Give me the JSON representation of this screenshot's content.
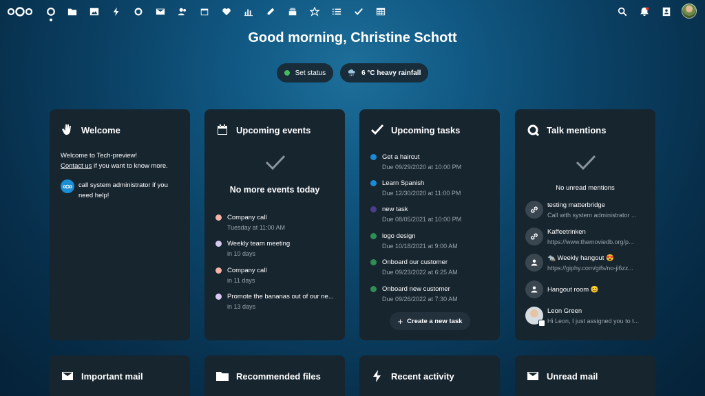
{
  "header": {
    "apps": [
      "Dashboard",
      "Files",
      "Photos",
      "Activity",
      "Talk",
      "Mail",
      "Contacts",
      "Calendar",
      "Favorites",
      "Analytics",
      "Notes",
      "Deck",
      "Bookmarks",
      "Tasks",
      "Checks",
      "Tables"
    ],
    "right": [
      "search-icon",
      "notifications-icon",
      "contacts-menu-icon"
    ]
  },
  "greeting": "Good morning, Christine Schott",
  "status": {
    "set_status": "Set status",
    "weather": "6 °C heavy rainfall"
  },
  "welcome": {
    "title": "Welcome",
    "line1": "Welcome to Tech-preview!",
    "contact_link": "Contact us",
    "line2": " if you want to know more.",
    "admin_line1": "call system administrator if you",
    "admin_line2": "need help!"
  },
  "events": {
    "title": "Upcoming events",
    "empty": "No more events today",
    "items": [
      {
        "title": "Company call",
        "time": "Tuesday at 11:00 AM",
        "color": "#f3b3a8"
      },
      {
        "title": "Weekly team meeting",
        "time": "in 10 days",
        "color": "#d8c9f2"
      },
      {
        "title": "Company call",
        "time": "in 11 days",
        "color": "#f3b3a8"
      },
      {
        "title": "Promote the bananas out of our ne...",
        "time": "in 13 days",
        "color": "#d8c9f2"
      }
    ]
  },
  "tasks": {
    "title": "Upcoming tasks",
    "create": "Create a new task",
    "items": [
      {
        "title": "Get a haircut",
        "due": "Due 09/29/2020 at 10:00 PM",
        "color": "#1a8ad6"
      },
      {
        "title": "Learn Spanish",
        "due": "Due 12/30/2020 at 11:00 PM",
        "color": "#1a8ad6"
      },
      {
        "title": "new task",
        "due": "Due 08/05/2021 at 10:00 PM",
        "color": "#4a3d8f"
      },
      {
        "title": "logo design",
        "due": "Due 10/18/2021 at 9:00 AM",
        "color": "#2e8f54"
      },
      {
        "title": "Onboard our customer",
        "due": "Due 09/23/2022 at 6:25 AM",
        "color": "#2e8f54"
      },
      {
        "title": "Onboard new customer",
        "due": "Due 09/26/2022 at 7:30 AM",
        "color": "#2e8f54"
      }
    ]
  },
  "talk": {
    "title": "Talk mentions",
    "empty": "No unread mentions",
    "items": [
      {
        "title": "testing matterbridge",
        "sub": "Call with system administrator ...",
        "icon": "link-icon"
      },
      {
        "title": "Kaffeetrinken",
        "sub": "https://www.themoviedb.org/p...",
        "icon": "link-icon"
      },
      {
        "title": "🐀 Weekly hangout 😍",
        "sub": "https://giphy.com/gifs/no-ji6zz...",
        "icon": "group-icon"
      },
      {
        "title": "Hangout room 😊",
        "sub": "",
        "icon": "group-icon"
      },
      {
        "title": "Leon Green",
        "sub": "Hi Leon, I just assigned you to t...",
        "icon": "user-avatar"
      }
    ]
  },
  "bottom": {
    "mail": "Important mail",
    "files": "Recommended files",
    "activity": "Recent activity",
    "unread": "Unread mail"
  }
}
